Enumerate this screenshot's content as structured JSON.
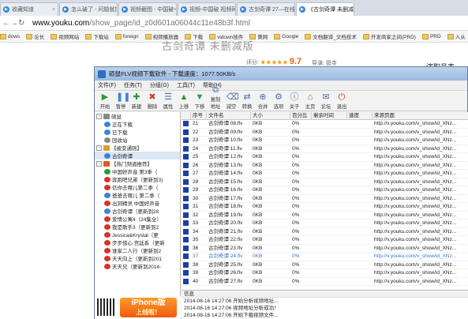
{
  "browser": {
    "tabs": [
      {
        "label": "收藏知道",
        "active": false
      },
      {
        "label": "怎么破了 - 问题就搜说",
        "active": false
      },
      {
        "label": "视频截图 - 中国破",
        "active": false
      },
      {
        "label": "视频-中国破 视频网站",
        "active": false
      },
      {
        "label": "古剑奇谭 27—在线观看",
        "active": false
      },
      {
        "label": "《古剑奇谭 未删减版》第",
        "active": true
      }
    ],
    "url_host": "www.youku.com",
    "url_path": "/show_page/id_z0d601a06044c11e48b3f.html",
    "bookmarks": [
      "dows",
      "论长",
      "视频网站",
      "下载站",
      "foreign",
      "视频播放器",
      "下载",
      "vidown插件",
      "黄网",
      "Google",
      "文档翻译_文档技术",
      "开发商家之间(PRD)",
      "PRD",
      "人从"
    ]
  },
  "page": {
    "title": "古剑奇谭 未删减版",
    "rating_prefix": "评分:",
    "stars": "★★★★★",
    "score": "9.7",
    "director": "导演: 管寺",
    "side_label": "演职员表"
  },
  "app": {
    "title": "硕鼠FLV视频下载软件 - 下载速度：1077.50KB/s",
    "menu": [
      "文件(F)",
      "任务(T)",
      "分组(G)",
      "工具(T)",
      "帮助(H)"
    ],
    "toolbar": [
      {
        "label": "开始",
        "icon": "play-icon"
      },
      {
        "label": "暂停",
        "icon": "pause-icon"
      },
      {
        "label": "新建",
        "icon": "new-icon"
      },
      {
        "label": "删除",
        "icon": "delete-icon"
      },
      {
        "label": "属性",
        "icon": "properties-icon"
      },
      {
        "label": "上移",
        "icon": "up-icon"
      },
      {
        "label": "下移",
        "icon": "down-icon"
      },
      {
        "label": "复制地址",
        "icon": "copy-icon"
      },
      {
        "label": "减空",
        "icon": "clear-icon"
      },
      {
        "label": "转换",
        "icon": "convert-icon"
      },
      {
        "label": "合并",
        "icon": "merge-icon"
      },
      {
        "label": "选项",
        "icon": "options-icon"
      },
      {
        "label": "关于",
        "icon": "about-icon"
      },
      {
        "label": "主页",
        "icon": "home-icon"
      },
      {
        "label": "论坛",
        "icon": "forum-icon"
      },
      {
        "label": "退出",
        "icon": "exit-icon"
      }
    ],
    "tree": [
      {
        "label": "硕鼠",
        "level": 0,
        "color": "#888",
        "expander": "-"
      },
      {
        "label": "正在下载",
        "level": 1,
        "color": "#3a86d8",
        "expander": ""
      },
      {
        "label": "已下载",
        "level": 1,
        "color": "#3a86d8",
        "expander": ""
      },
      {
        "label": "回收站",
        "level": 1,
        "color": "#888",
        "expander": ""
      },
      {
        "label": "【被变通则】",
        "level": 0,
        "color": "#d9a12b",
        "expander": "-"
      },
      {
        "label": "古剑奇谭",
        "level": 1,
        "color": "#3a86d8",
        "expander": ""
      },
      {
        "label": "【热门频道推荐】",
        "level": 0,
        "color": "#e05a20",
        "expander": "-"
      },
      {
        "label": "中国好声音 第3季（",
        "level": 1,
        "color": "#2a9a3a",
        "expander": ""
      },
      {
        "label": "奔跑吧兄弟（更新到3)",
        "level": 1,
        "color": "#d8322a",
        "expander": ""
      },
      {
        "label": "信你去哪儿第二季（",
        "level": 1,
        "color": "#d8322a",
        "expander": ""
      },
      {
        "label": "爸爸去哪儿 第二季（",
        "level": 1,
        "color": "#3a86d8",
        "expander": ""
      },
      {
        "label": "出洞精灵 中国好声音",
        "level": 1,
        "color": "#d8322a",
        "expander": ""
      },
      {
        "label": "古剑奇谭（更新到28",
        "level": 1,
        "color": "#3a86d8",
        "expander": ""
      },
      {
        "label": "爱情公寓4（24集全）",
        "level": 1,
        "color": "#d8322a",
        "expander": ""
      },
      {
        "label": "我是歌手3（更新到2",
        "level": 1,
        "color": "#d8322a",
        "expander": ""
      },
      {
        "label": "Jessica&Krystal（更",
        "level": 1,
        "color": "#d8322a",
        "expander": ""
      },
      {
        "label": "步步惊心 宫廷系（更新",
        "level": 1,
        "color": "#d8322a",
        "expander": ""
      },
      {
        "label": "谁家二人行（更新到2",
        "level": 1,
        "color": "#d8322a",
        "expander": ""
      },
      {
        "label": "天天向上（更新到201",
        "level": 1,
        "color": "#d8322a",
        "expander": ""
      },
      {
        "label": "天天兄（更新到2014-",
        "level": 1,
        "color": "#d8322a",
        "expander": ""
      }
    ],
    "columns": [
      "",
      "序号",
      "文件名",
      "大小",
      "百分比",
      "剩余时间",
      "速度",
      "来源页面"
    ],
    "rows": [
      {
        "n": "21",
        "file": "古剑奇谭 08.flv",
        "size": "0KB",
        "pct": "0%",
        "src": "http://v.youku.com/v_show/id_XNz..."
      },
      {
        "n": "22",
        "file": "古剑奇谭 09.flv",
        "size": "0KB",
        "pct": "0%",
        "src": "http://v.youku.com/v_show/id_XNz..."
      },
      {
        "n": "23",
        "file": "古剑奇谭 10.flv",
        "size": "0KB",
        "pct": "0%",
        "src": "http://v.youku.com/v_show/id_XNz..."
      },
      {
        "n": "24",
        "file": "古剑奇谭 11.flv",
        "size": "0KB",
        "pct": "0%",
        "src": "http://v.youku.com/v_show/id_XNz..."
      },
      {
        "n": "25",
        "file": "古剑奇谭 12.flv",
        "size": "0KB",
        "pct": "0%",
        "src": "http://v.youku.com/v_show/id_XNz..."
      },
      {
        "n": "26",
        "file": "古剑奇谭 13.flv",
        "size": "0KB",
        "pct": "0%",
        "src": "http://v.youku.com/v_show/id_XNz..."
      },
      {
        "n": "27",
        "file": "古剑奇谭 14.flv",
        "size": "0KB",
        "pct": "0%",
        "src": "http://v.youku.com/v_show/id_XNz..."
      },
      {
        "n": "28",
        "file": "古剑奇谭 15.flv",
        "size": "0KB",
        "pct": "0%",
        "src": "http://v.youku.com/v_show/id_XNz..."
      },
      {
        "n": "29",
        "file": "古剑奇谭 16.flv",
        "size": "0KB",
        "pct": "0%",
        "src": "http://v.youku.com/v_show/id_XNz..."
      },
      {
        "n": "30",
        "file": "古剑奇谭 17.flv",
        "size": "0KB",
        "pct": "0%",
        "src": "http://v.youku.com/v_show/id_XNz..."
      },
      {
        "n": "31",
        "file": "古剑奇谭 18.flv",
        "size": "0KB",
        "pct": "0%",
        "src": "http://v.youku.com/v_show/id_XNz..."
      },
      {
        "n": "32",
        "file": "古剑奇谭 19.flv",
        "size": "0KB",
        "pct": "0%",
        "src": "http://v.youku.com/v_show/id_XNz..."
      },
      {
        "n": "33",
        "file": "古剑奇谭 20.flv",
        "size": "0KB",
        "pct": "0%",
        "src": "http://v.youku.com/v_show/id_XNz..."
      },
      {
        "n": "34",
        "file": "古剑奇谭 21.flv",
        "size": "0KB",
        "pct": "0%",
        "src": "http://v.youku.com/v_show/id_XNz..."
      },
      {
        "n": "35",
        "file": "古剑奇谭 22.flv",
        "size": "0KB",
        "pct": "0%",
        "src": "http://v.youku.com/v_show/id_XNz..."
      },
      {
        "n": "36",
        "file": "古剑奇谭 23.flv",
        "size": "0KB",
        "pct": "0%",
        "src": "http://v.youku.com/v_show/id_XNz..."
      },
      {
        "n": "37",
        "file": "古剑奇谭 24.flv",
        "size": "0KB",
        "pct": "0%",
        "src": "http://v.youku.com/v_show/id_XNz...",
        "highlight": true
      },
      {
        "n": "38",
        "file": "古剑奇谭 25.flv",
        "size": "0KB",
        "pct": "0%",
        "src": "http://v.youku.com/v_show/id_XNz..."
      },
      {
        "n": "39",
        "file": "古剑奇谭 26.flv",
        "size": "0KB",
        "pct": "0%",
        "src": "http://v.youku.com/v_show/id_XNz..."
      },
      {
        "n": "40",
        "file": "古剑奇谭 27.flv",
        "size": "0KB",
        "pct": "0%",
        "src": "http://v.youku.com/v_show/id_XNz..."
      }
    ],
    "log_header": "信息",
    "log": [
      "2014-08-16 14:27:06 开始分析视频地址...",
      "2014-08-16 14:27:06 视频地址分析成功！",
      "2014-08-16 14:27:06 开始下载视频文件..."
    ],
    "ad": {
      "line1": "iPhone版",
      "line2": "上线啦！"
    }
  }
}
